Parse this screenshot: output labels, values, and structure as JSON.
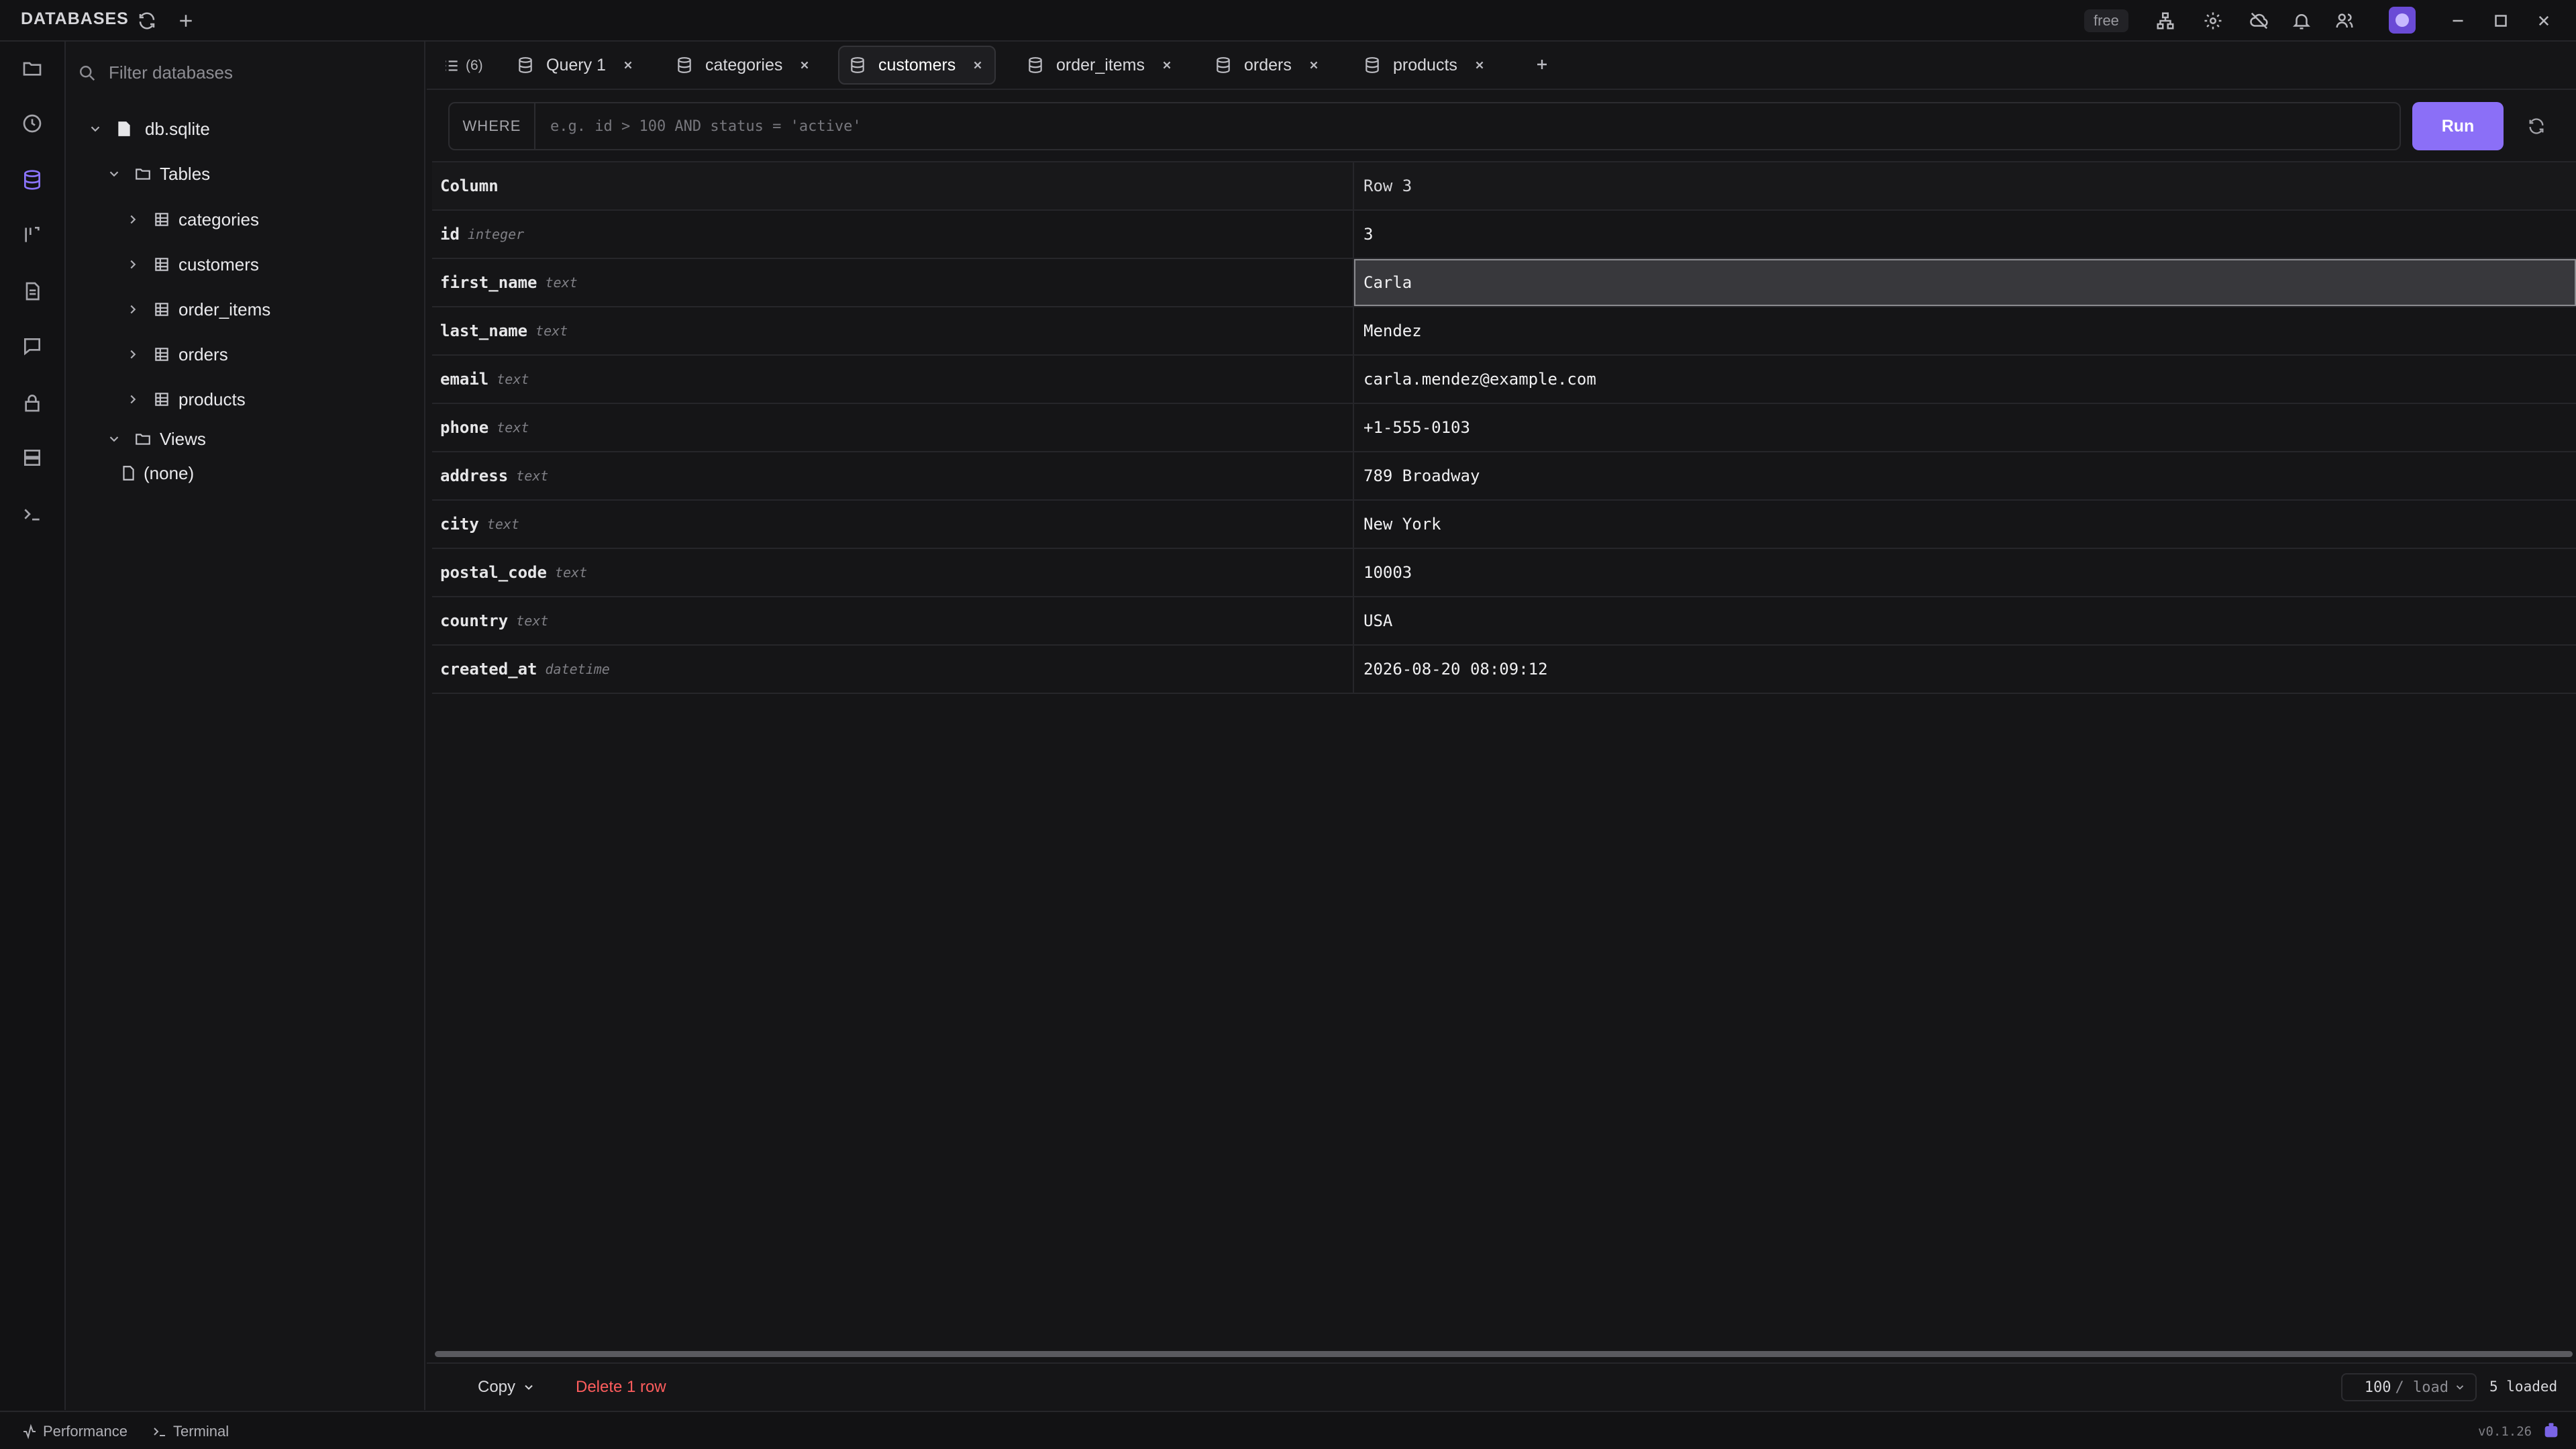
{
  "app": {
    "section_label": "DATABASES",
    "plan_badge": "free"
  },
  "sidebar": {
    "filter_placeholder": "Filter databases",
    "database": "db.sqlite",
    "tables_label": "Tables",
    "tables": [
      "categories",
      "customers",
      "order_items",
      "orders",
      "products"
    ],
    "views_label": "Views",
    "views": [
      "(none)"
    ]
  },
  "tabs": {
    "count": "(6)",
    "items": [
      {
        "label": "Query 1",
        "active": false
      },
      {
        "label": "categories",
        "active": false
      },
      {
        "label": "customers",
        "active": true
      },
      {
        "label": "order_items",
        "active": false
      },
      {
        "label": "orders",
        "active": false
      },
      {
        "label": "products",
        "active": false
      }
    ]
  },
  "filter_bar": {
    "where_label": "WHERE",
    "placeholder": "e.g. id > 100 AND status = 'active'",
    "run_label": "Run"
  },
  "record": {
    "header": {
      "column": "Column",
      "row": "Row 3"
    },
    "fields": [
      {
        "name": "id",
        "type": "integer",
        "value": "3"
      },
      {
        "name": "first_name",
        "type": "text",
        "value": "Carla",
        "selected": true
      },
      {
        "name": "last_name",
        "type": "text",
        "value": "Mendez"
      },
      {
        "name": "email",
        "type": "text",
        "value": "carla.mendez@example.com"
      },
      {
        "name": "phone",
        "type": "text",
        "value": "+1-555-0103"
      },
      {
        "name": "address",
        "type": "text",
        "value": "789 Broadway"
      },
      {
        "name": "city",
        "type": "text",
        "value": "New York"
      },
      {
        "name": "postal_code",
        "type": "text",
        "value": "10003"
      },
      {
        "name": "country",
        "type": "text",
        "value": "USA"
      },
      {
        "name": "created_at",
        "type": "datetime",
        "value": "2026-08-20 08:09:12"
      }
    ]
  },
  "footer": {
    "copy_label": "Copy",
    "delete_label": "Delete 1 row",
    "page_size": "100",
    "page_size_unit": "/ load",
    "loaded_text": "5 loaded"
  },
  "statusbar": {
    "performance_label": "Performance",
    "terminal_label": "Terminal",
    "version": "v0.1.26"
  },
  "colors": {
    "accent": "#8b6ff7",
    "danger": "#ff5d5d",
    "background": "#151517"
  },
  "icons": {
    "titlebar": [
      "refresh-icon",
      "plus-icon",
      "network-icon",
      "gear-icon",
      "cloud-off-icon",
      "bell-icon",
      "users-icon",
      "avatar",
      "minimize-icon",
      "maximize-icon",
      "close-icon"
    ],
    "rail": [
      "folder-icon",
      "history-icon",
      "database-icon",
      "columns-icon",
      "document-icon",
      "chat-icon",
      "lock-icon",
      "server-icon",
      "terminal-icon"
    ]
  }
}
